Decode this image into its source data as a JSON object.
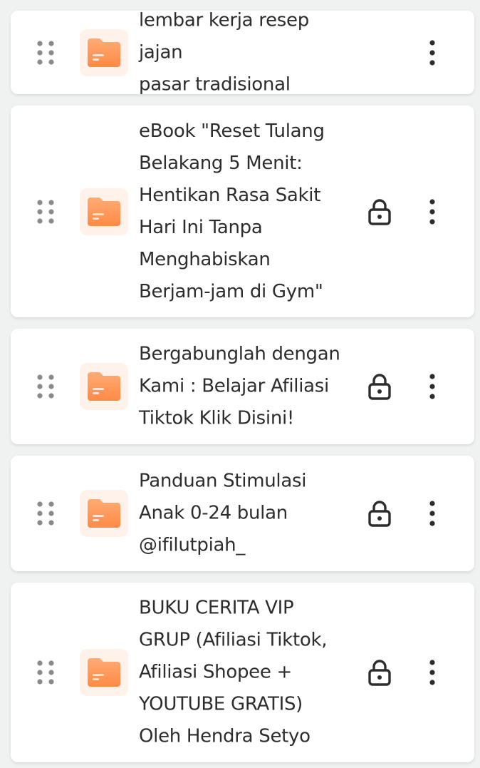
{
  "items": [
    {
      "title": "lembar kerja resep jajan\npasar tradisional",
      "locked": false
    },
    {
      "title": "eBook \"Reset Tulang\nBelakang 5 Menit:\nHentikan Rasa Sakit\nHari Ini Tanpa\nMenghabiskan\nBerjam-jam di Gym\"",
      "locked": true
    },
    {
      "title": "Bergabunglah dengan\nKami : Belajar Afiliasi\nTiktok Klik Disini!",
      "locked": true
    },
    {
      "title": "Panduan Stimulasi\nAnak 0-24 bulan\n@ifilutpiah_",
      "locked": true
    },
    {
      "title": "BUKU CERITA VIP\nGRUP (Afiliasi Tiktok,\nAfiliasi Shopee +\nYOUTUBE GRATIS)\nOleh Hendra Setyo",
      "locked": true
    }
  ],
  "icons": {
    "drag": "drag-handle-icon",
    "folder": "folder-icon",
    "lock": "lock-icon",
    "more": "more-vertical-icon"
  },
  "colors": {
    "background": "#f0f2f1",
    "card": "#ffffff",
    "folder_accent": "#ff9a5c",
    "icon": "#2d2d2d",
    "drag_dots": "#8a8a8a"
  }
}
